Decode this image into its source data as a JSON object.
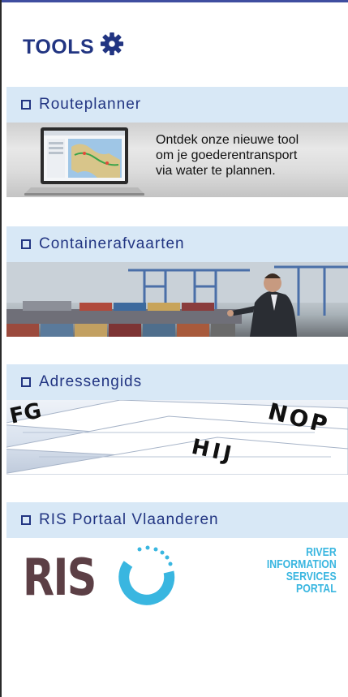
{
  "header": {
    "title": "TOOLS",
    "icon": "gear-icon"
  },
  "colors": {
    "title": "#223582",
    "section_bg": "#d8e8f6",
    "ris_brown": "#5c3f45",
    "ris_blue": "#39b6e0"
  },
  "sections": [
    {
      "label": "Routeplanner",
      "banner_text": [
        "Ontdek onze nieuwe tool",
        "om je goederentransport",
        "via water te plannen."
      ]
    },
    {
      "label": "Containerafvaarten"
    },
    {
      "label": "Adressengids",
      "banner_letters": [
        "FG",
        "NOP",
        "HIJ"
      ]
    },
    {
      "label": "RIS Portaal Vlaanderen",
      "logo_text": "RIS",
      "tagline": [
        "RIVER",
        "INFORMATION",
        "SERVICES",
        "PORTAL"
      ]
    }
  ]
}
